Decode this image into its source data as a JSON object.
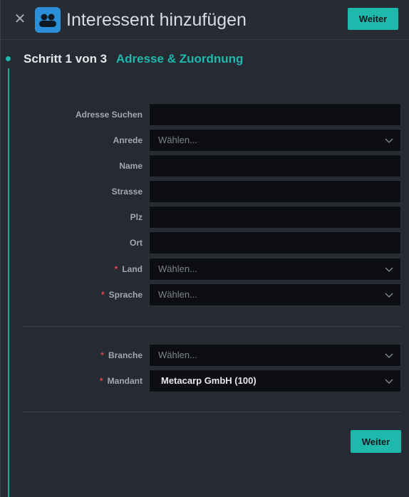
{
  "header": {
    "close_glyph": "✕",
    "title": "Interessent hinzufügen",
    "next_label": "Weiter"
  },
  "step": {
    "main": "Schritt 1 von 3",
    "sub": "Adresse & Zuordnung"
  },
  "form": {
    "address_search": {
      "label": "Adresse Suchen",
      "value": ""
    },
    "salutation": {
      "label": "Anrede",
      "placeholder": "Wählen..."
    },
    "name": {
      "label": "Name",
      "value": ""
    },
    "street": {
      "label": "Strasse",
      "value": ""
    },
    "zip": {
      "label": "Plz",
      "value": ""
    },
    "city": {
      "label": "Ort",
      "value": ""
    },
    "country": {
      "label": "Land",
      "placeholder": "Wählen...",
      "required": "*"
    },
    "language": {
      "label": "Sprache",
      "placeholder": "Wählen...",
      "required": "*"
    },
    "industry": {
      "label": "Branche",
      "placeholder": "Wählen...",
      "required": "*"
    },
    "client": {
      "label": "Mandant",
      "value": "Metacarp GmbH (100)",
      "required": "*"
    }
  },
  "footer": {
    "next_label": "Weiter"
  },
  "colors": {
    "accent": "#1fb8ad",
    "required": "#e0464f",
    "app_icon": "#2a8fd6"
  },
  "icons": [
    "close-icon",
    "contacts-icon",
    "chevron-down-icon"
  ]
}
